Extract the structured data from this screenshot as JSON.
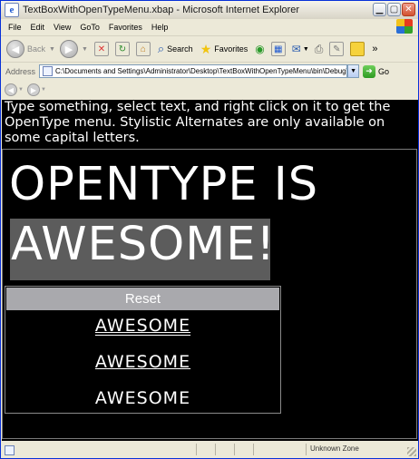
{
  "window": {
    "title": "TextBoxWithOpenTypeMenu.xbap - Microsoft Internet Explorer",
    "caption_buttons": [
      "minimize",
      "maximize",
      "close"
    ]
  },
  "menu_bar": {
    "items": [
      "File",
      "Edit",
      "View",
      "GoTo",
      "Favorites",
      "Help"
    ]
  },
  "toolbar": {
    "back_label": "Back",
    "search_label": "Search",
    "favorites_label": "Favorites",
    "overflow": "»"
  },
  "address_bar": {
    "label": "Address",
    "value": "C:\\Documents and Settings\\Administrator\\Desktop\\TextBoxWithOpenTypeMenu\\bin\\Debug\\TextI",
    "go_label": "Go"
  },
  "content": {
    "instructions": "Type something, select text, and right click on it to get the OpenType menu. Stylistic Alternates are only available on some capital letters.",
    "line1": "OPENTYPE IS",
    "line2_selected": "AWESOME",
    "line2_rest": "!"
  },
  "context_menu": {
    "reset_label": "Reset",
    "options": [
      "AWESOME",
      "AWESOME",
      "AWESOME"
    ]
  },
  "status_bar": {
    "zone": "Unknown Zone"
  },
  "colors": {
    "content_bg": "#000000",
    "selection": "#5c5c5c",
    "reset_bg": "#a9a9ad",
    "title_bar": "#e4e1d6"
  }
}
